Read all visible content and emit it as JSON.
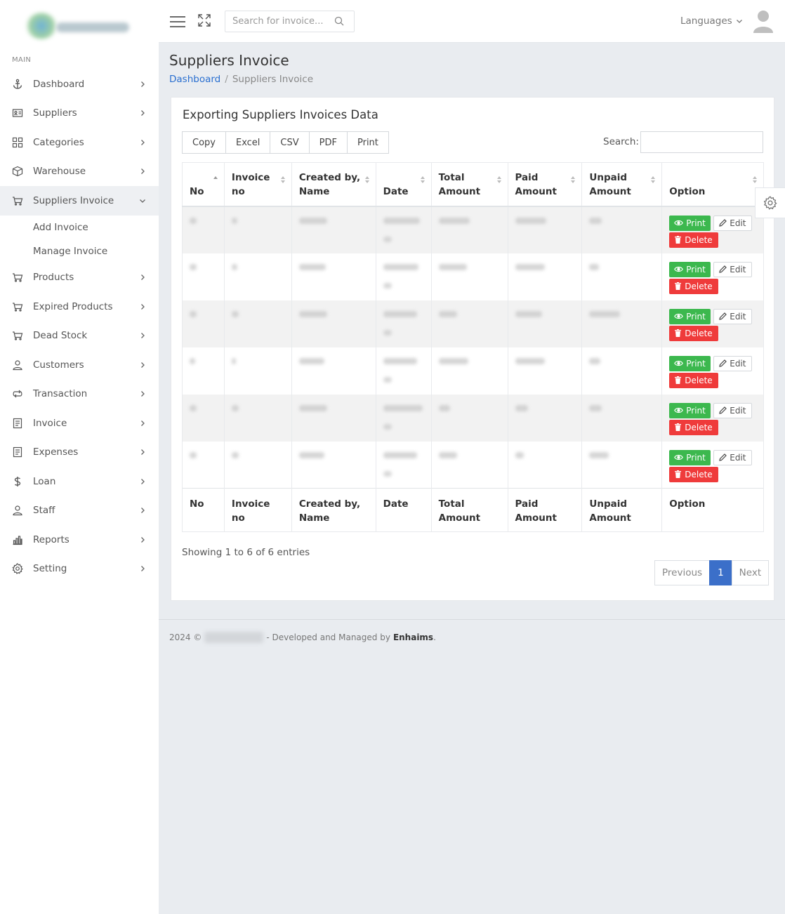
{
  "sidebar": {
    "section_label": "MAIN",
    "items": [
      {
        "label": "Dashboard",
        "icon": "anchor-icon"
      },
      {
        "label": "Suppliers",
        "icon": "id-card-icon"
      },
      {
        "label": "Categories",
        "icon": "grid-icon"
      },
      {
        "label": "Warehouse",
        "icon": "box-icon"
      },
      {
        "label": "Suppliers Invoice",
        "icon": "cart-icon"
      },
      {
        "label": "Products",
        "icon": "cart-icon"
      },
      {
        "label": "Expired Products",
        "icon": "cart-icon"
      },
      {
        "label": "Dead Stock",
        "icon": "cart-icon"
      },
      {
        "label": "Customers",
        "icon": "user-icon"
      },
      {
        "label": "Transaction",
        "icon": "exchange-icon"
      },
      {
        "label": "Invoice",
        "icon": "document-icon"
      },
      {
        "label": "Expenses",
        "icon": "document-icon"
      },
      {
        "label": "Loan",
        "icon": "dollar-icon"
      },
      {
        "label": "Staff",
        "icon": "user-icon"
      },
      {
        "label": "Reports",
        "icon": "bar-chart-icon"
      },
      {
        "label": "Setting",
        "icon": "gear-icon"
      }
    ],
    "submenu": [
      "Add Invoice",
      "Manage Invoice"
    ]
  },
  "header": {
    "search_placeholder": "Search for invoice...",
    "languages": "Languages"
  },
  "page": {
    "title": "Suppliers Invoice",
    "breadcrumb": [
      "Dashboard",
      "Suppliers Invoice"
    ]
  },
  "card": {
    "title": "Exporting Suppliers Invoices Data",
    "export_buttons": [
      "Copy",
      "Excel",
      "CSV",
      "PDF",
      "Print"
    ],
    "search_label": "Search:",
    "columns": [
      "No",
      "Invoice no",
      "Created by, Name",
      "Date",
      "Total Amount",
      "Paid Amount",
      "Unpaid Amount",
      "Option"
    ],
    "row_actions": {
      "print": "Print",
      "edit": "Edit",
      "delete": "Delete"
    },
    "row_count": 6,
    "showing": "Showing 1 to 6 of 6 entries",
    "pager": {
      "previous": "Previous",
      "current": "1",
      "next": "Next"
    }
  },
  "footer": {
    "year": "2024 ©",
    "developed": "- Developed and Managed by",
    "brand": "Enhaims",
    "end": "."
  },
  "colors": {
    "primary": "#3b6fc9",
    "success": "#3cb84e",
    "danger": "#ef3b3b"
  }
}
